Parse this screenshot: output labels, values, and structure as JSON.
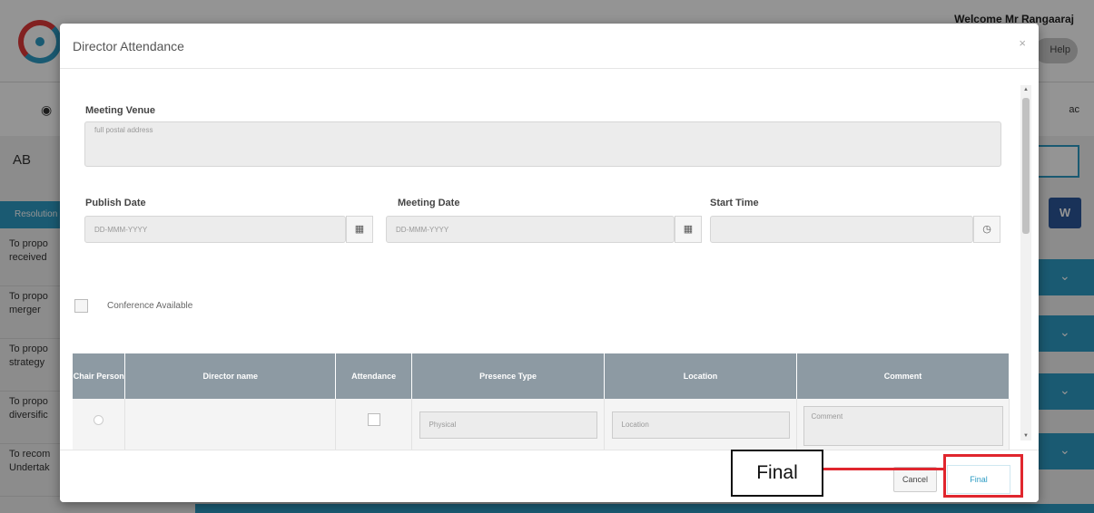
{
  "background": {
    "welcome": "Welcome Mr Rangaaraj",
    "help_label": "Help",
    "section_label": "AB",
    "left_tab_label": "Resolution",
    "left_items": [
      "To propo\nreceived",
      "To propo\nmerger",
      "To propo\nstrategy",
      "To propo\ndiversific",
      "To recom\nUndertak"
    ],
    "word_icon": "W",
    "nav_right": "ac"
  },
  "modal": {
    "title": "Director Attendance",
    "close_icon": "×",
    "meeting_venue": {
      "label": "Meeting Venue",
      "placeholder": "full postal address"
    },
    "publish_date": {
      "label": "Publish Date",
      "placeholder": "DD-MMM-YYYY",
      "icon": "calendar-icon"
    },
    "meeting_date": {
      "label": "Meeting Date",
      "placeholder": "DD-MMM-YYYY",
      "icon": "calendar-icon"
    },
    "start_time": {
      "label": "Start Time",
      "placeholder": "",
      "icon": "clock-icon"
    },
    "conference": {
      "label": "Conference Available",
      "checked": false
    },
    "table": {
      "headers": [
        "Chair Person",
        "Director name",
        "Attendance",
        "Presence Type",
        "Location",
        "Comment"
      ],
      "rows": [
        {
          "director_name": "",
          "attendance": false,
          "presence_type": "Physical",
          "location": "Location",
          "comment": "Comment"
        }
      ]
    },
    "footer": {
      "cancel_label": "Cancel",
      "final_label": "Final"
    }
  },
  "annotation": {
    "label": "Final",
    "color": "#e0262e"
  },
  "colors": {
    "accent": "#2d9cc4",
    "table_header": "#8d9aa3"
  }
}
